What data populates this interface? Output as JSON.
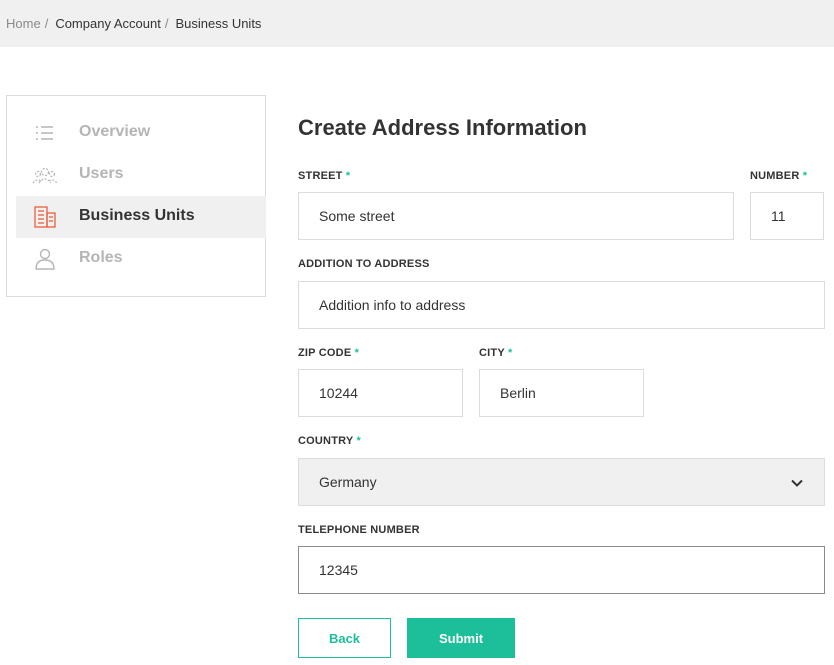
{
  "breadcrumb": {
    "items": [
      "Home",
      "Company Account",
      "Business Units"
    ],
    "separator": "/"
  },
  "sidebar": {
    "items": [
      {
        "label": "Overview",
        "icon": "list-icon",
        "active": false
      },
      {
        "label": "Users",
        "icon": "users-icon",
        "active": false
      },
      {
        "label": "Business Units",
        "icon": "building-icon",
        "active": true
      },
      {
        "label": "Roles",
        "icon": "user-icon",
        "active": false
      }
    ]
  },
  "form": {
    "title": "Create Address Information",
    "required_mark": "*",
    "street": {
      "label": "STREET",
      "value": "Some street"
    },
    "number": {
      "label": "NUMBER",
      "value": "11"
    },
    "addition": {
      "label": "ADDITION TO ADDRESS",
      "value": "Addition info to address"
    },
    "zip": {
      "label": "ZIP CODE",
      "value": "10244"
    },
    "city": {
      "label": "CITY",
      "value": "Berlin"
    },
    "country": {
      "label": "COUNTRY",
      "value": "Germany"
    },
    "telephone": {
      "label": "TELEPHONE NUMBER",
      "value": "12345"
    }
  },
  "actions": {
    "back_label": "Back",
    "submit_label": "Submit"
  },
  "colors": {
    "accent": "#1dbf9a",
    "active_icon": "#e8603c",
    "inactive_text": "#b5b5b5"
  }
}
